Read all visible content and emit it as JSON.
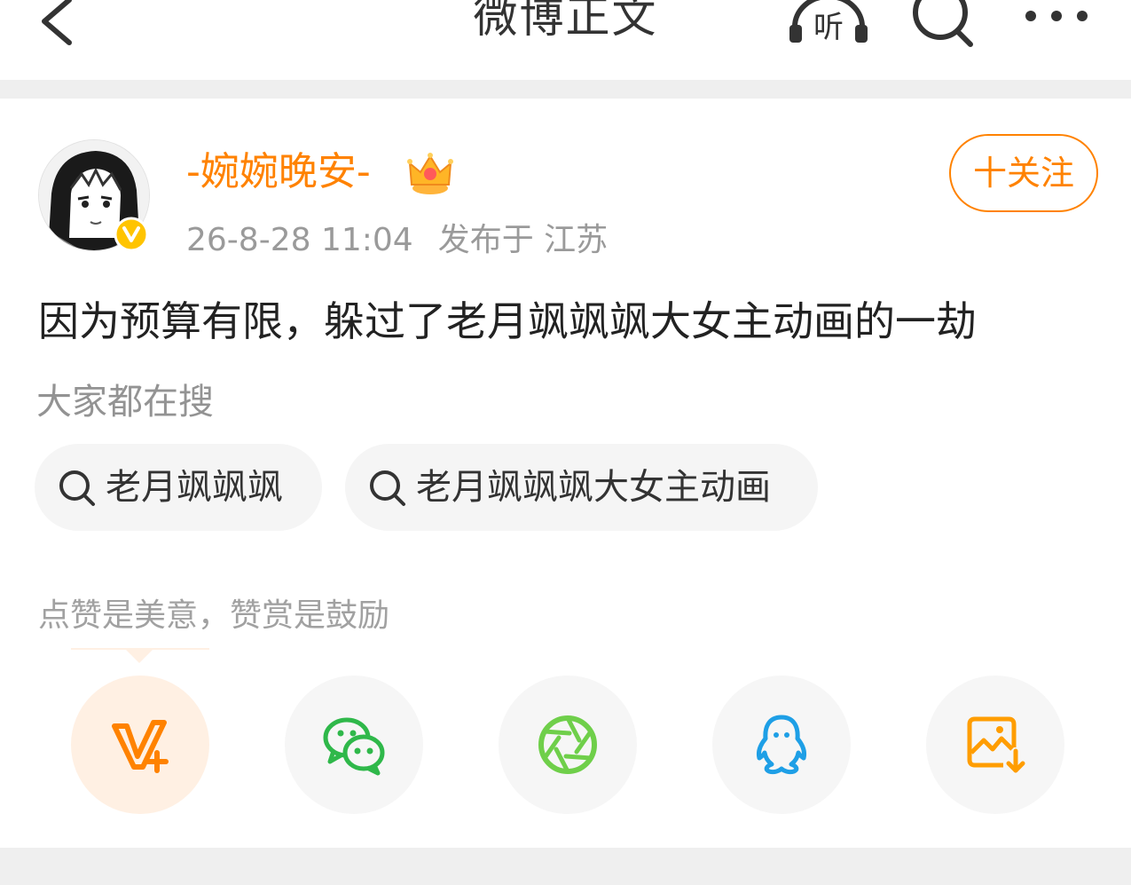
{
  "header": {
    "title": "微博正文",
    "listen_icon_label": "听",
    "icons": [
      "back-icon",
      "listen-icon",
      "search-icon",
      "more-icon"
    ]
  },
  "post": {
    "username": "-婉婉晚安-",
    "timestamp": "26-8-28 11:04",
    "location": "发布于 江苏",
    "follow_label": "十关注",
    "text": "因为预算有限，躲过了老月飒飒飒大女主动画的一劫"
  },
  "search": {
    "hint": "大家都在搜",
    "chips": [
      {
        "label": "老月飒飒飒"
      },
      {
        "label": "老月飒飒飒大女主动画"
      }
    ]
  },
  "reward": {
    "hint": "点赞是美意，赞赏是鼓励"
  },
  "share": {
    "items": [
      {
        "icon": "v-plus-icon",
        "color": "#ff8200"
      },
      {
        "icon": "wechat-icon",
        "color": "#2fb84a"
      },
      {
        "icon": "moments-icon",
        "color": "#6fcf4a"
      },
      {
        "icon": "qq-icon",
        "color": "#1e9fe6"
      },
      {
        "icon": "save-image-icon",
        "color": "#ff9d00"
      }
    ]
  },
  "colors": {
    "accent": "#ff8200",
    "verified": "#ffc400",
    "background_band": "#efefef"
  }
}
